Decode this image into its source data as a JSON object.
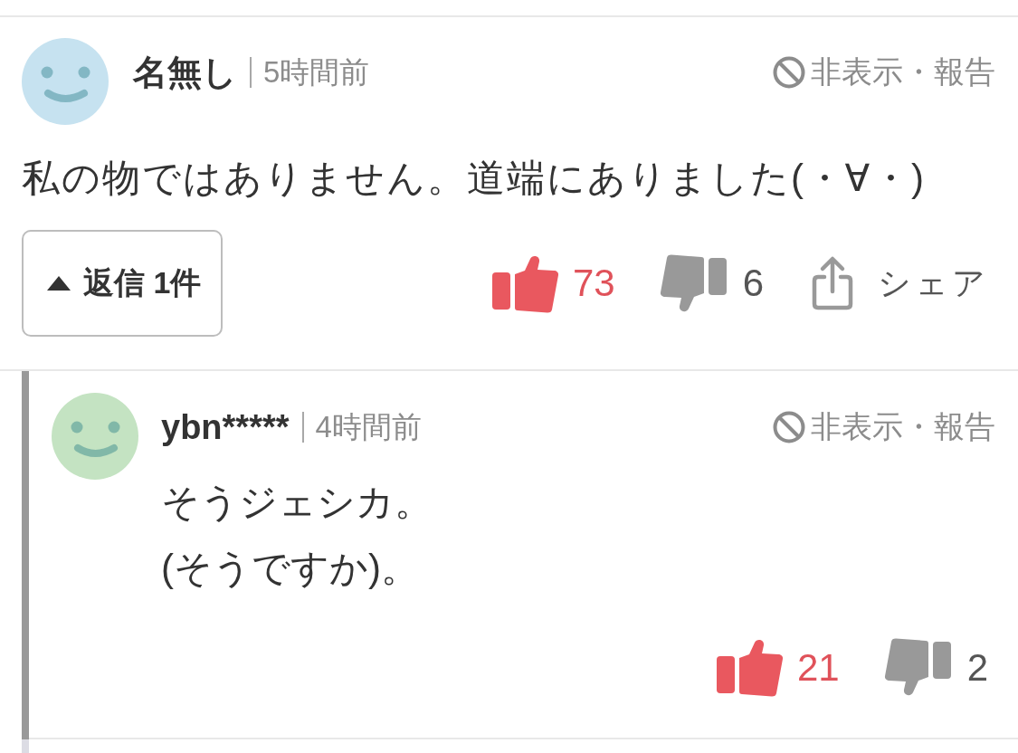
{
  "comments": [
    {
      "author": "名無し",
      "color": "#c6e2f0",
      "time": "5時間前",
      "hide_report": "非表示・報告",
      "body": "私の物ではありません。道端にありました(・∀・)",
      "replies_toggle": {
        "label": "返信 1件",
        "expanded": true
      },
      "likes": "73",
      "dislikes": "6",
      "share": "シェア",
      "replies": [
        {
          "author": "ybn*****",
          "color": "#c4e3c2",
          "time": "4時間前",
          "hide_report": "非表示・報告",
          "body": "そうジェシカ。\n(そうですか)。",
          "likes": "21",
          "dislikes": "2"
        }
      ]
    }
  ]
}
